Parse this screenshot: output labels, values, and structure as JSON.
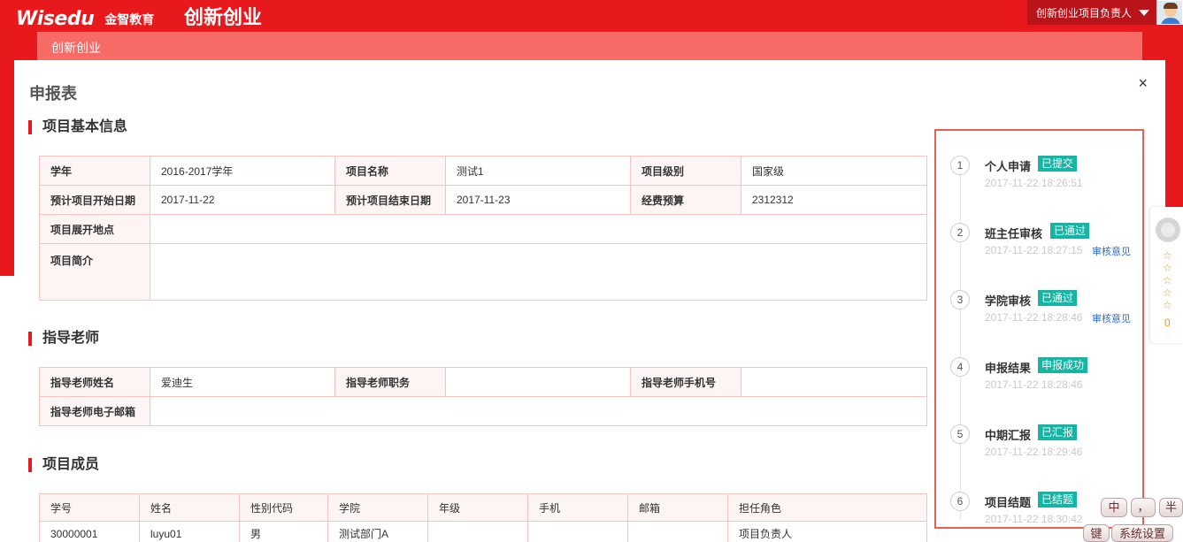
{
  "header": {
    "logo_text": "Wisedu",
    "logo_cn": "金智教育",
    "app_title": "创新创业",
    "user_name": "创新创业项目负责人"
  },
  "subnav": {
    "label": "创新创业"
  },
  "modal": {
    "title": "申报表",
    "close_label": "×"
  },
  "basic_info": {
    "section_title": "项目基本信息",
    "row1": [
      "学年",
      "2016-2017学年",
      "项目名称",
      "测试1",
      "项目级别",
      "国家级"
    ],
    "row2": [
      "预计项目开始日期",
      "2017-11-22",
      "预计项目结束日期",
      "2017-11-23",
      "经费预算",
      "2312312"
    ],
    "row3": [
      "项目展开地点",
      ""
    ],
    "row4": [
      "项目简介",
      ""
    ]
  },
  "advisor": {
    "section_title": "指导老师",
    "row1": [
      "指导老师姓名",
      "爱迪生",
      "指导老师职务",
      "",
      "指导老师手机号",
      ""
    ],
    "row2": [
      "指导老师电子邮箱",
      ""
    ]
  },
  "members": {
    "section_title": "项目成员",
    "headers": [
      "学号",
      "姓名",
      "性别代码",
      "学院",
      "年级",
      "手机",
      "邮箱",
      "担任角色"
    ],
    "rows": [
      [
        "30000001",
        "luyu01",
        "男",
        "测试部门A",
        "",
        "",
        "",
        "项目负责人"
      ]
    ]
  },
  "timeline": {
    "steps": [
      {
        "num": "1",
        "label": "个人申请",
        "badge": "已提交",
        "time": "2017-11-22 18:26:51",
        "link": ""
      },
      {
        "num": "2",
        "label": "班主任审核",
        "badge": "已通过",
        "time": "2017-11-22 18:27:15",
        "link": "审核意见"
      },
      {
        "num": "3",
        "label": "学院审核",
        "badge": "已通过",
        "time": "2017-11-22 18:28:46",
        "link": "审核意见"
      },
      {
        "num": "4",
        "label": "申报结果",
        "badge": "申报成功",
        "time": "2017-11-22 18:28:46",
        "link": ""
      },
      {
        "num": "5",
        "label": "中期汇报",
        "badge": "已汇报",
        "time": "2017-11-22 18:29:46",
        "link": ""
      },
      {
        "num": "6",
        "label": "项目结题",
        "badge": "已结题",
        "time": "2017-11-22 18:30:42",
        "link": ""
      }
    ]
  },
  "float_widget": {
    "stars": "☆☆☆☆☆",
    "count": "0"
  },
  "ime": {
    "zh": "中",
    "punct": "，",
    "half": "半",
    "key": "键",
    "settings": "系统设置"
  },
  "colors": {
    "brand_red": "#e8191d",
    "badge_teal": "#19b3a4",
    "link_blue": "#2e6fc5"
  }
}
